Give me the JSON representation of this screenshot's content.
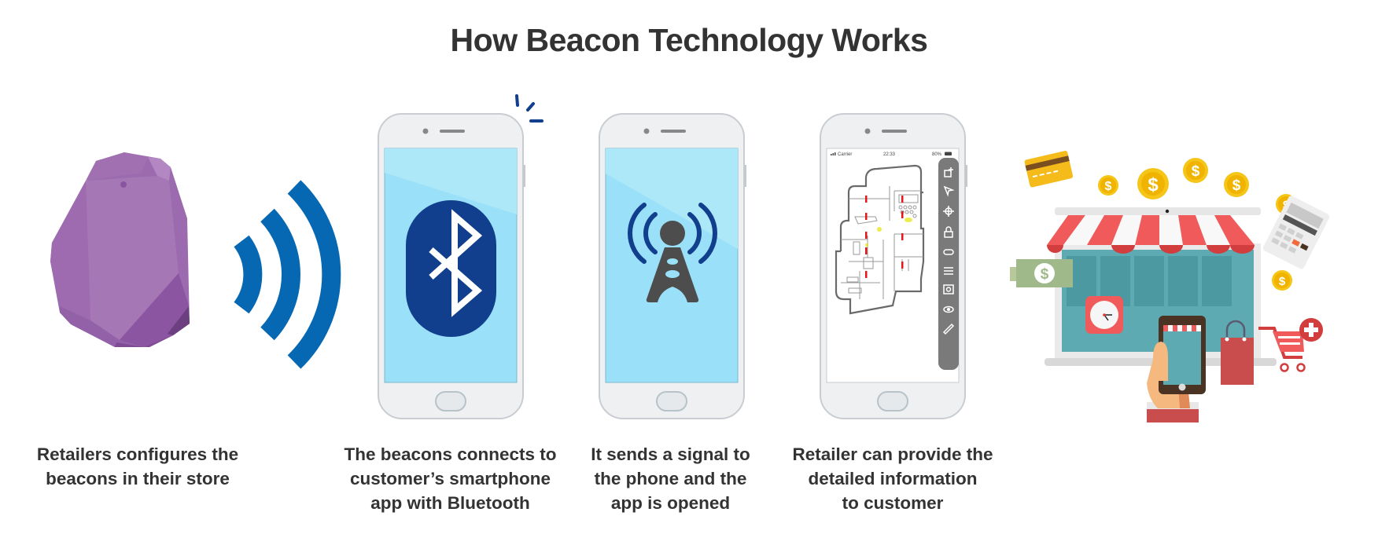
{
  "title": "How Beacon Technology Works",
  "steps": [
    {
      "illustration": "beacon-device-with-signal-waves",
      "caption_lines": [
        "Retailers configures the",
        "beacons in their store"
      ]
    },
    {
      "illustration": "phone-with-bluetooth-icon",
      "caption_lines": [
        "The beacons connects to",
        "customer’s smartphone",
        "app with Bluetooth"
      ]
    },
    {
      "illustration": "phone-with-signal-tower-icon",
      "caption_lines": [
        "It sends a signal to",
        "the phone and the",
        "app is opened"
      ]
    },
    {
      "illustration": "phone-with-floor-plan-app",
      "caption_lines": [
        "Retailer can provide the",
        "detailed information",
        "to customer"
      ],
      "status_bar": {
        "carrier": "Carrier",
        "time": "22:33",
        "battery": "80%"
      },
      "toolbar_icons": [
        "add-icon",
        "pointer-icon",
        "locate-icon",
        "lock-icon",
        "toggle-icon",
        "sliders-icon",
        "settings-icon",
        "eye-icon",
        "edit-icon"
      ]
    },
    {
      "illustration": "online-store-shopping",
      "coin_symbol": "$"
    }
  ],
  "colors": {
    "title_text": "#333333",
    "beacon_purple": "#9b6bb0",
    "signal_blue": "#0668b3",
    "bluetooth_navy": "#123f8d",
    "screen_blue": "#9ae0f8",
    "tower_gray": "#4d4d4d",
    "awning_red": "#f05a5a",
    "coin_gold": "#f5c518"
  }
}
